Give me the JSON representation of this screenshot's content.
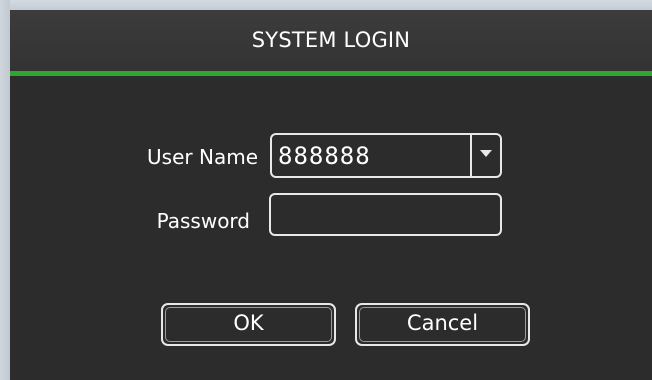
{
  "dialog": {
    "title": "SYSTEM LOGIN"
  },
  "form": {
    "username_label": "User Name",
    "username_value": "888888",
    "password_label": "Password",
    "password_value": ""
  },
  "buttons": {
    "ok_label": "OK",
    "cancel_label": "Cancel"
  },
  "icons": {
    "dropdown": "chevron-down-icon"
  },
  "colors": {
    "dialog_background": "#2c2c2c",
    "accent": "#2fa62f",
    "text": "#ffffff",
    "border": "#e8e8e8"
  }
}
